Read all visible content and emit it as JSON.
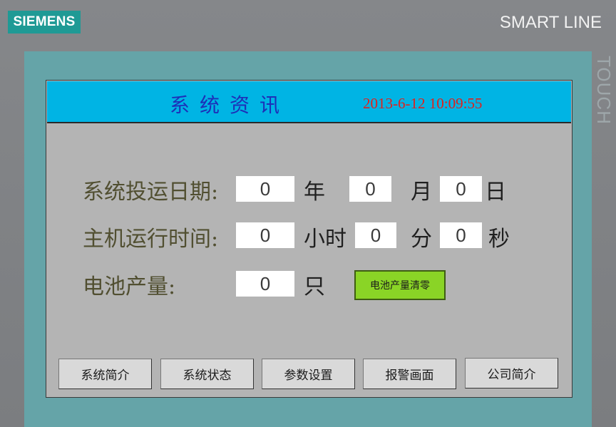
{
  "hardware": {
    "brand": "SIEMENS",
    "model": "SMART LINE",
    "touch_label": "TOUCH"
  },
  "header": {
    "title": "系统资讯",
    "datetime": "2013-6-12 10:09:55"
  },
  "commission_date": {
    "label": "系统投运日期:",
    "year": "0",
    "year_unit": "年",
    "month": "0",
    "month_unit": "月",
    "day": "0",
    "day_unit": "日"
  },
  "runtime": {
    "label": "主机运行时间:",
    "hours": "0",
    "hours_unit": "小时",
    "minutes": "0",
    "minutes_unit": "分",
    "seconds": "0",
    "seconds_unit": "秒"
  },
  "battery_output": {
    "label": "电池产量:",
    "value": "0",
    "unit": "只",
    "reset_label": "电池产量清零"
  },
  "nav": [
    {
      "label": "系统简介"
    },
    {
      "label": "系统状态"
    },
    {
      "label": "参数设置"
    },
    {
      "label": "报警画面"
    },
    {
      "label": "公司简介"
    }
  ],
  "colors": {
    "title_bar": "#00b4e4",
    "title_text": "#1d2fb8",
    "clock_text": "#e0211d",
    "reset_button": "#8ad426",
    "brand_badge": "#1f9a95"
  }
}
